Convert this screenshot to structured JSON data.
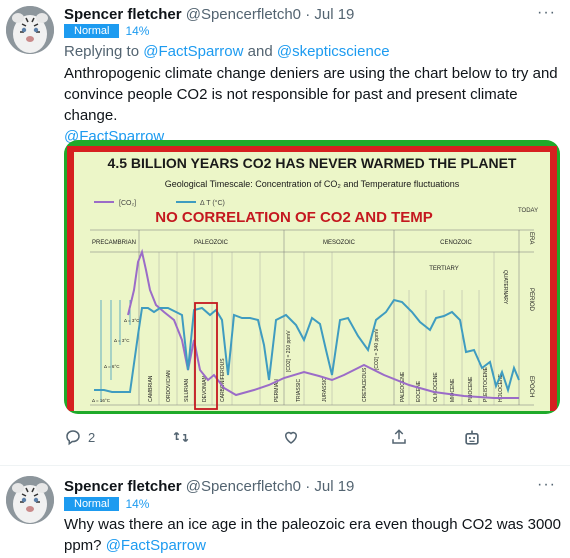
{
  "tweets": [
    {
      "author_name": "Spencer fletcher",
      "handle": "@Spencerfletch0",
      "sep": "·",
      "date": "Jul 19",
      "badge": "Normal",
      "badge_pct": "14%",
      "reply_prefix": "Replying to ",
      "reply_user1": "@FactSparrow",
      "reply_and": " and ",
      "reply_user2": "@skepticscience",
      "text": "Anthropogenic climate change deniers are using the chart below to try and convince people CO2 is not responsible for past and present climate change.",
      "mention": "@FactSparrow",
      "more": "···",
      "actions": {
        "reply_count": "2"
      }
    },
    {
      "author_name": "Spencer fletcher",
      "handle": "@Spencerfletch0",
      "sep": "·",
      "date": "Jul 19",
      "badge": "Normal",
      "badge_pct": "14%",
      "text": "Why was there an ice age in the paleozoic era even though CO2 was 3000 ppm?",
      "mention": "@FactSparrow",
      "more": "···"
    }
  ],
  "chart_image": {
    "title": "4.5 BILLION YEARS CO2 HAS NEVER WARMED THE PLANET",
    "subtitle": "Geological Timescale: Concentration of CO₂ and Temperature fluctuations",
    "legend_co2": "[CO₂]",
    "legend_temp": "Δ T (°C)",
    "banner": "NO CORRELATION OF CO2 AND TEMP",
    "today": "TODAY",
    "eras": [
      "PRECAMBRIAN",
      "PALEOZOIC",
      "MESOZOIC",
      "CENOZOIC",
      "ERA"
    ],
    "tertiary": "TERTIARY",
    "period_label": "PERIOD",
    "quaternary": "QUATERNARY",
    "epoch_label": "EPOCH",
    "periods": [
      "CAMBRIAN",
      "ORDOVICIAN",
      "SILURIAN",
      "DEVONIAN",
      "CARBONIFEROUS",
      "PERMIAN",
      "TRIASSIC",
      "JURASSIC",
      "CRETACEOUS",
      "PALEOCENE",
      "EOCENE",
      "OLIGOCENE",
      "MIOCENE",
      "PLIOCENE",
      "PLEISTOCENE",
      "HOLOCENE"
    ],
    "co2_annotations": [
      "[CO2] = 210 ppmV",
      "[CO2] = 340 ppmV"
    ],
    "temp_marks": [
      "Δ = 3°C",
      "Δ = 3°C",
      "Δ = 6°C",
      "Δ = 16°C"
    ],
    "colors": {
      "border_outer": "#1faa2a",
      "border_inner": "#d62020",
      "panel": "#ecf6c8",
      "co2": "#9b6cc8",
      "temp": "#3f9cc0",
      "banner": "#c4181f"
    }
  },
  "avatar_icon": "white-tiger-avatar"
}
